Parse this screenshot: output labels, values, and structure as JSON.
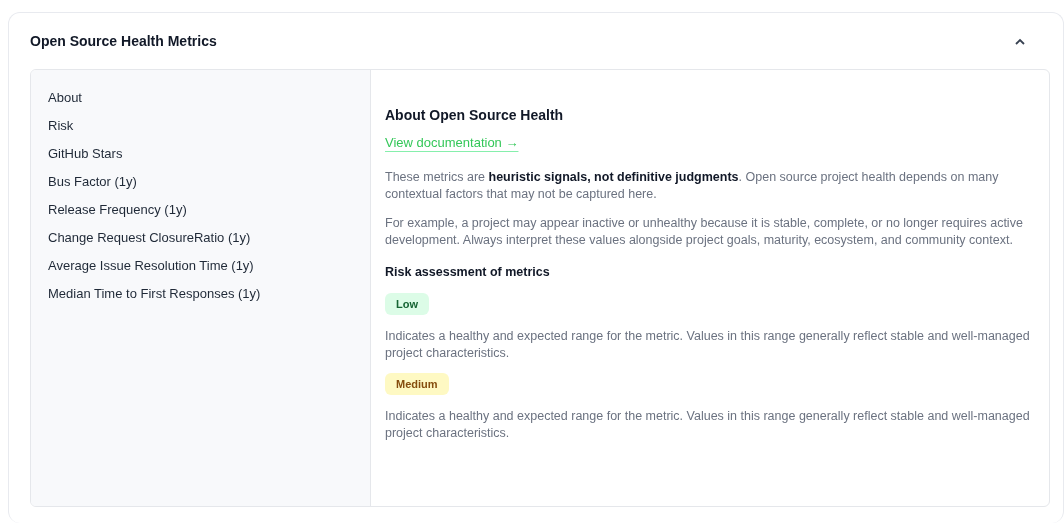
{
  "section": {
    "title": "Open Source Health Metrics",
    "expanded": true
  },
  "sidebar": {
    "items": [
      {
        "label": "About"
      },
      {
        "label": "Risk"
      },
      {
        "label": "GitHub Stars"
      },
      {
        "label": "Bus Factor (1y)"
      },
      {
        "label": "Release Frequency (1y)"
      },
      {
        "label": "Change Request ClosureRatio (1y)"
      },
      {
        "label": "Average Issue Resolution Time (1y)"
      },
      {
        "label": "Median Time to First Responses (1y)"
      }
    ]
  },
  "content": {
    "heading": "About Open Source Health",
    "link": "View documentation →",
    "paragraphs": [
      "These metrics are **heuristic signals, not definitive judgments**. Open source project health depends on many contextual factors that may not be captured here.",
      "For example, a project may appear inactive or unhealthy because it is stable, complete, or no longer requires active development. Always interpret these values alongside project goals, maturity, ecosystem, and community context."
    ],
    "risk_heading": "Risk assessment of metrics",
    "risk_levels": [
      {
        "kind": "low",
        "label": "Low",
        "description": "Indicates a healthy and expected range for the metric. Values in this range generally reflect stable and well-managed project characteristics."
      },
      {
        "kind": "medium",
        "label": "Medium",
        "description": "Indicates a healthy and expected range for the metric. Values in this range generally reflect stable and well-managed project characteristics."
      }
    ]
  }
}
